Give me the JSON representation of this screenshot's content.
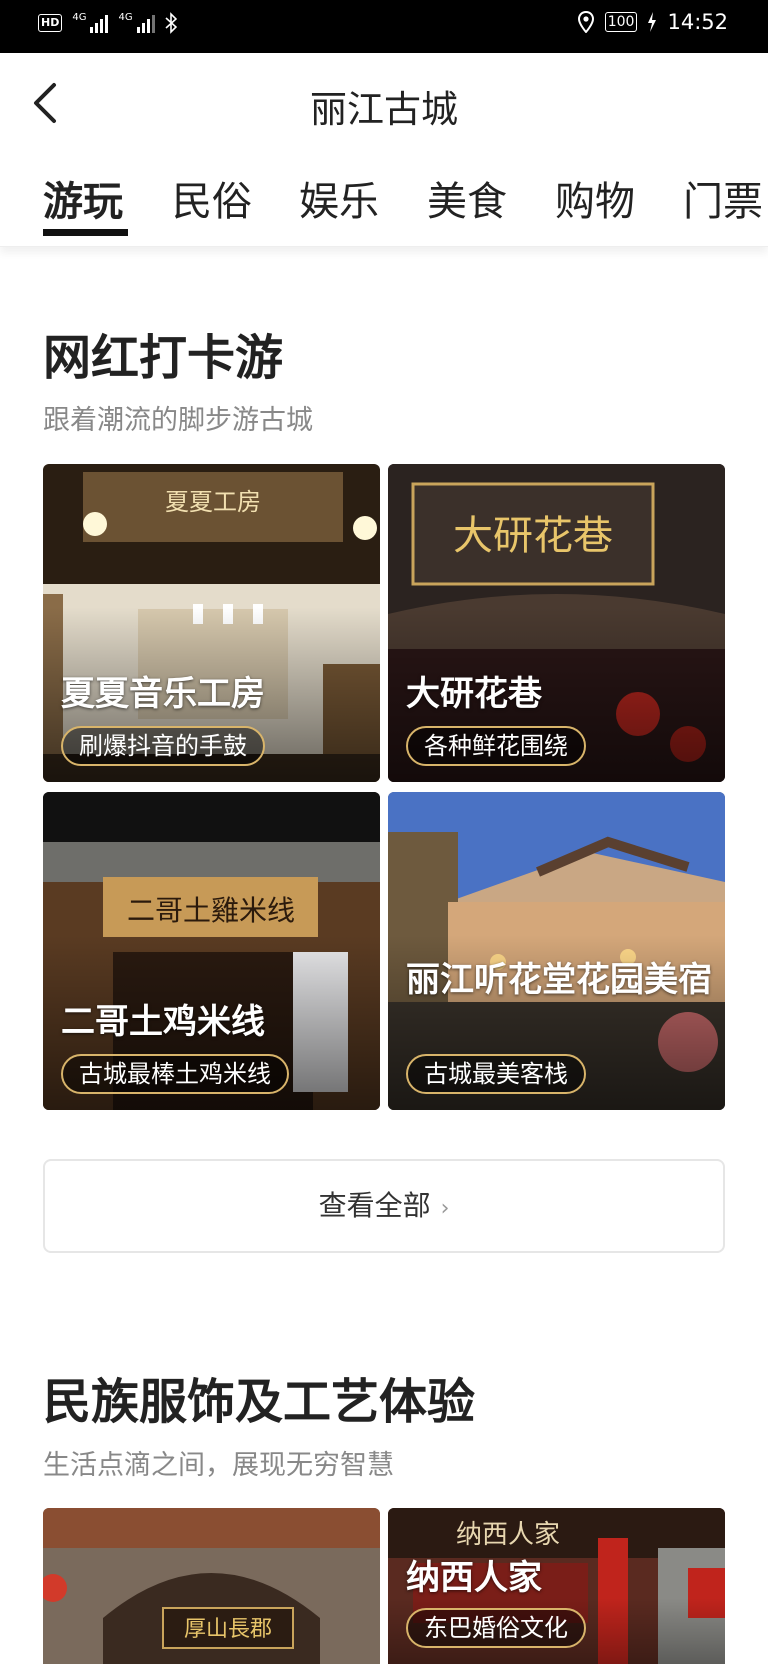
{
  "status_bar": {
    "hd": "HD",
    "net1": "4G",
    "net2": "4G",
    "battery": "100",
    "time": "14:52"
  },
  "header": {
    "title": "丽江古城"
  },
  "tabs": [
    {
      "label": "游玩",
      "active": true
    },
    {
      "label": "民俗",
      "active": false
    },
    {
      "label": "娱乐",
      "active": false
    },
    {
      "label": "美食",
      "active": false
    },
    {
      "label": "购物",
      "active": false
    },
    {
      "label": "门票",
      "active": false
    }
  ],
  "section1": {
    "title": "网红打卡游",
    "subtitle": "跟着潮流的脚步游古城",
    "cards": [
      {
        "name": "夏夏音乐工房",
        "tag": "刷爆抖音的手鼓",
        "sign_text": "夏夏工房"
      },
      {
        "name": "大研花巷",
        "tag": "各种鲜花围绕",
        "sign_text": "大研花巷"
      },
      {
        "name": "二哥土鸡米线",
        "tag": "古城最棒土鸡米线",
        "sign_text": "二哥土雞米线"
      },
      {
        "name": "丽江听花堂花园美宿",
        "tag": "古城最美客栈",
        "sign_text": ""
      }
    ],
    "view_all": "查看全部"
  },
  "section2": {
    "title": "民族服饰及工艺体验",
    "subtitle": "生活点滴之间，展现无穷智慧",
    "cards": [
      {
        "name": "",
        "tag": "",
        "sign_text": "厚山長郡"
      },
      {
        "name": "纳西人家",
        "tag": "东巴婚俗文化",
        "sign_text": "纳西人家"
      }
    ]
  },
  "colors": {
    "tag_border": "#d8b46a",
    "status_bar": "#000000",
    "accent": "#111111"
  }
}
